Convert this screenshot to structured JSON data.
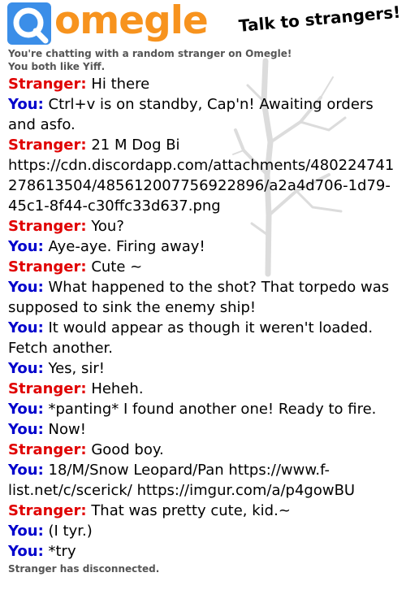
{
  "header": {
    "logo_text": "omegle",
    "tagline": "Talk to strangers!"
  },
  "status": {
    "chatting_notice": "You're chatting with a random stranger on Omegle!",
    "likes_notice": "You both like Yiff.",
    "end_notice": "Stranger has disconnected."
  },
  "labels": {
    "stranger": "Stranger:",
    "you": "You:"
  },
  "colors": {
    "stranger": "#e00000",
    "you": "#0000cc",
    "logo": "#f7931e",
    "logo_icon": "#3b8ee8"
  },
  "messages": [
    {
      "from": "stranger",
      "text": "Hi there"
    },
    {
      "from": "you",
      "text": "Ctrl+v is on standby, Cap'n! Awaiting orders and asfo."
    },
    {
      "from": "stranger",
      "text": "21 M Dog Bi https://cdn.discordapp.com/attachments/480224741278613504/485612007756922896/a2a4d706-1d79-45c1-8f44-c30ffc33d637.png"
    },
    {
      "from": "stranger",
      "text": "You?"
    },
    {
      "from": "you",
      "text": "Aye-aye. Firing away!"
    },
    {
      "from": "stranger",
      "text": "Cute ~"
    },
    {
      "from": "you",
      "text": "What happened to the shot? That torpedo was supposed to sink the enemy ship!"
    },
    {
      "from": "you",
      "text": "It would appear as though it weren't loaded. Fetch another."
    },
    {
      "from": "you",
      "text": "Yes, sir!"
    },
    {
      "from": "stranger",
      "text": "Heheh."
    },
    {
      "from": "you",
      "text": "*panting* I found another one! Ready to fire."
    },
    {
      "from": "you",
      "text": "Now!"
    },
    {
      "from": "stranger",
      "text": "Good boy."
    },
    {
      "from": "you",
      "text": "18/M/Snow Leopard/Pan https://www.f-list.net/c/scerick/ https://imgur.com/a/p4gowBU"
    },
    {
      "from": "stranger",
      "text": "That was pretty cute, kid.~"
    },
    {
      "from": "you",
      "text": "(I tyr.)"
    },
    {
      "from": "you",
      "text": "*try"
    }
  ]
}
